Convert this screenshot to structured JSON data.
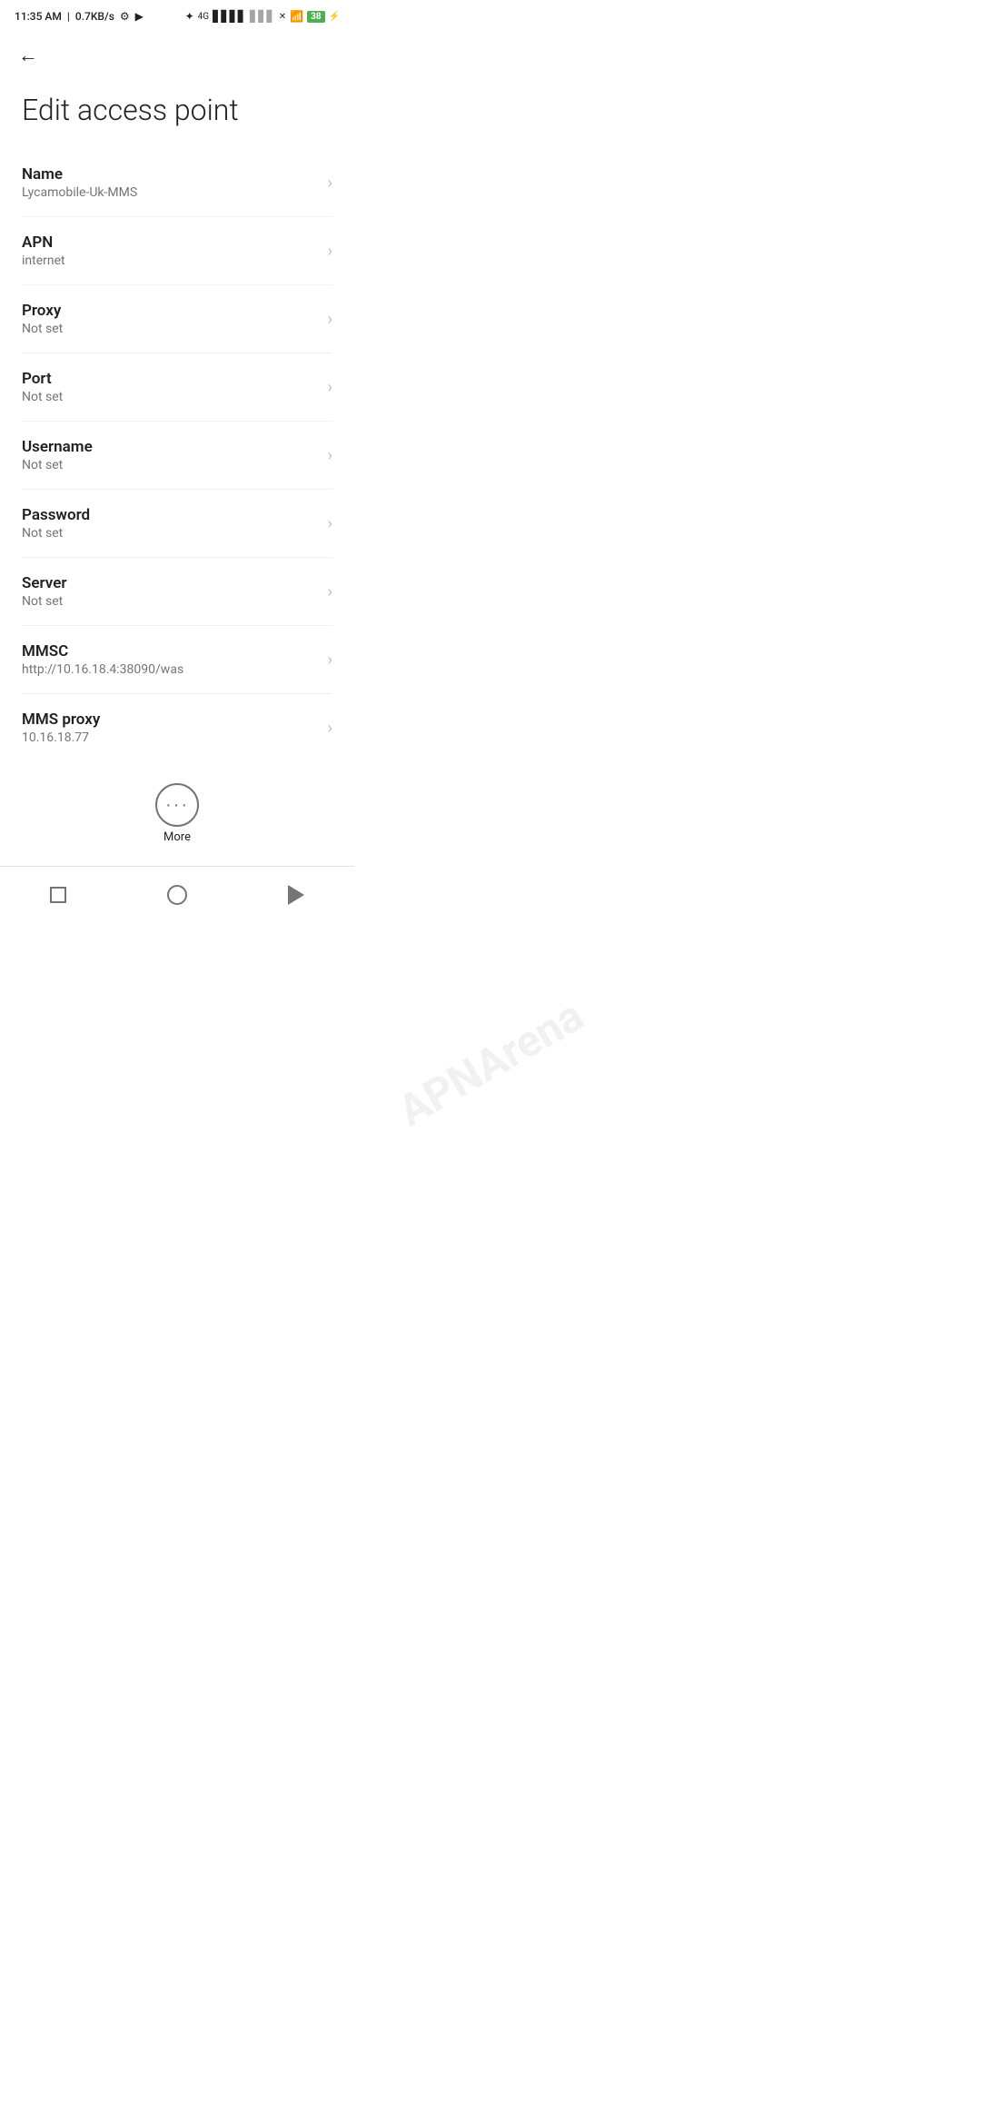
{
  "statusBar": {
    "time": "11:35 AM",
    "speed": "0.7KB/s",
    "battery": "38"
  },
  "page": {
    "title": "Edit access point",
    "backLabel": "Back"
  },
  "settings": [
    {
      "label": "Name",
      "value": "Lycamobile-Uk-MMS"
    },
    {
      "label": "APN",
      "value": "internet"
    },
    {
      "label": "Proxy",
      "value": "Not set"
    },
    {
      "label": "Port",
      "value": "Not set"
    },
    {
      "label": "Username",
      "value": "Not set"
    },
    {
      "label": "Password",
      "value": "Not set"
    },
    {
      "label": "Server",
      "value": "Not set"
    },
    {
      "label": "MMSC",
      "value": "http://10.16.18.4:38090/was"
    },
    {
      "label": "MMS proxy",
      "value": "10.16.18.77"
    }
  ],
  "more": {
    "label": "More"
  },
  "watermark": {
    "line1": "APNArena"
  }
}
